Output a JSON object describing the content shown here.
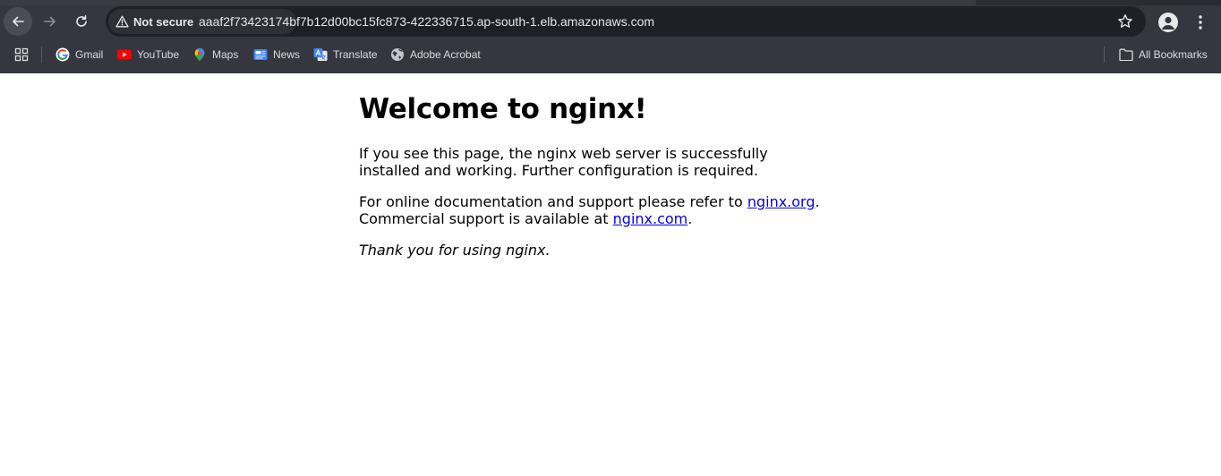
{
  "browser": {
    "security_label": "Not secure",
    "url": "aaaf2f73423174bf7b12d00bc15fc873-422336715.ap-south-1.elb.amazonaws.com",
    "colors": {
      "frame": "#35363f",
      "omnibox": "#1f1f28",
      "text": "#e6e6e8"
    }
  },
  "bookmarks": {
    "items": [
      {
        "label": "Gmail",
        "icon": "google-icon"
      },
      {
        "label": "YouTube",
        "icon": "youtube-icon"
      },
      {
        "label": "Maps",
        "icon": "maps-icon"
      },
      {
        "label": "News",
        "icon": "news-icon"
      },
      {
        "label": "Translate",
        "icon": "translate-icon"
      },
      {
        "label": "Adobe Acrobat",
        "icon": "globe-icon"
      }
    ],
    "all_label": "All Bookmarks"
  },
  "page": {
    "heading": "Welcome to nginx!",
    "para1": "If you see this page, the nginx web server is successfully installed and working. Further configuration is required.",
    "para2_prefix": "For online documentation and support please refer to ",
    "link1": "nginx.org",
    "para2_mid": "Commercial support is available at ",
    "link2": "nginx.com",
    "closing": "Thank you for using nginx.",
    "link_color": "#0000ee"
  }
}
